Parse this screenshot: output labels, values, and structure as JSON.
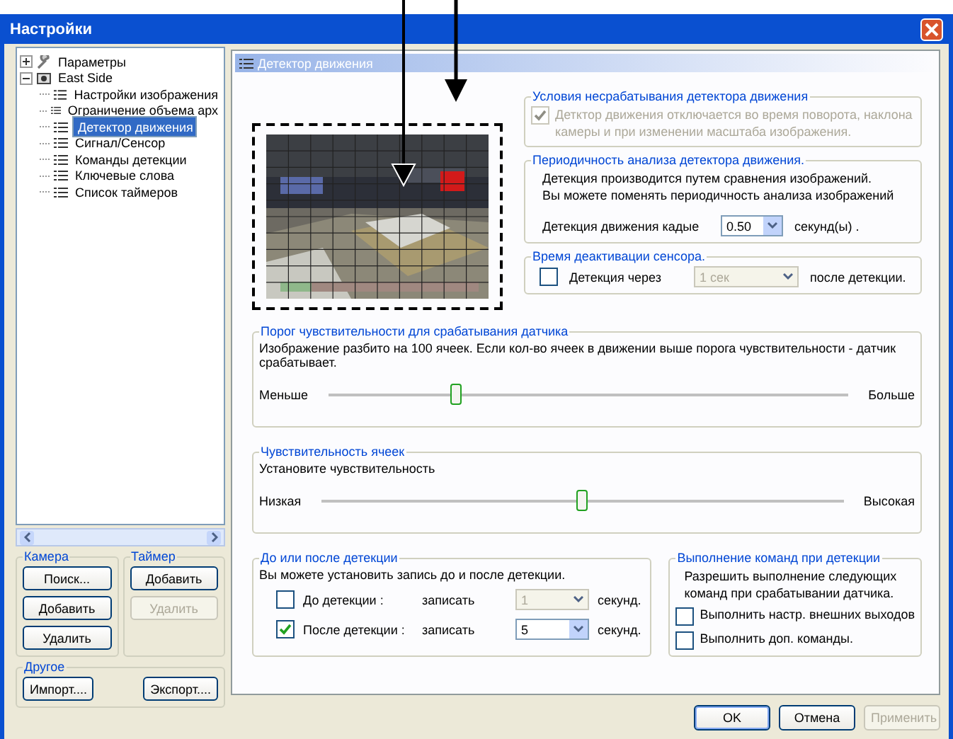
{
  "window": {
    "title": "Настройки"
  },
  "tree": [
    {
      "label": "Параметры",
      "kind": "settings",
      "expanded": false,
      "selected": false
    },
    {
      "label": "East Side",
      "kind": "camera",
      "expanded": true,
      "selected": false,
      "children": [
        {
          "label": "Настройки изображения",
          "kind": "page",
          "selected": false
        },
        {
          "label": "Ограничение объема арх",
          "kind": "page",
          "selected": false
        },
        {
          "label": "Детектор движения",
          "kind": "page",
          "selected": true
        },
        {
          "label": "Сигнал/Сенсор",
          "kind": "page",
          "selected": false
        },
        {
          "label": "Команды детекции",
          "kind": "page",
          "selected": false
        },
        {
          "label": "Ключевые слова",
          "kind": "page",
          "selected": false
        },
        {
          "label": "Список таймеров",
          "kind": "page",
          "selected": false
        }
      ]
    }
  ],
  "camera_group": {
    "title": "Камера",
    "buttons": [
      {
        "label": "Поиск...",
        "disabled": false
      },
      {
        "label": "Добавить",
        "disabled": false
      },
      {
        "label": "Удалить",
        "disabled": false
      }
    ]
  },
  "timer_group": {
    "title": "Таймер",
    "buttons": [
      {
        "label": "Добавить",
        "disabled": false
      },
      {
        "label": "Удалить",
        "disabled": true
      }
    ]
  },
  "other_group": {
    "title": "Другое",
    "buttons": [
      {
        "label": "Импорт....",
        "disabled": false
      },
      {
        "label": "Экспорт....",
        "disabled": false
      }
    ]
  },
  "panel": {
    "title": "Детектор движения"
  },
  "no_trigger": {
    "title": "Условия несрабатывания детектора движения",
    "checkbox": {
      "label": "Детктор движения отключается во время поворота, наклона камеры и при изменении масштаба изображения.",
      "checked": true,
      "disabled": true
    }
  },
  "period": {
    "title": "Периодичность анализа детектора движения.",
    "lines": [
      "Детекция производится путем сравнения изображений.",
      "Вы можете поменять периодичность анализа изображений"
    ],
    "label": "Детекция движения кадые",
    "value": "0.50",
    "unit": "секунд(ы) ."
  },
  "deactivation": {
    "title": "Время деактивации сенсора.",
    "checkbox": {
      "label": "Детекция через",
      "checked": false
    },
    "select": {
      "value": "1 сек",
      "disabled": true
    },
    "suffix": "после детекции."
  },
  "threshold": {
    "title": "Порог чувствительности для срабатывания датчика",
    "text": "Изображение разбито на 100 ячеек. Если кол-во ячеек в движении выше порога чувствительности - датчик срабатывает.",
    "min_label": "Меньше",
    "max_label": "Больше",
    "level": 0.245
  },
  "cell_sensitivity": {
    "title": "Чувствительность ячеек",
    "text": "Установите чувствительность",
    "min_label": "Низкая",
    "max_label": "Высокая",
    "level": 0.5
  },
  "record": {
    "title": "До или после детекции",
    "text": "Вы можете установить запись до и после детекции.",
    "rows": [
      {
        "label": "До детекции :",
        "checked": false,
        "action": "записать",
        "value": "1",
        "disabled": true,
        "unit": "секунд."
      },
      {
        "label": "После детекции :",
        "checked": true,
        "action": "записать",
        "value": "5",
        "disabled": false,
        "unit": "секунд."
      }
    ]
  },
  "commands": {
    "title": "Выполнение команд при детекции",
    "text": "Разрешить выполнение следующих команд при срабатывании датчика.",
    "options": [
      {
        "label": "Выполнить настр. внешних выходов",
        "checked": false
      },
      {
        "label": "Выполнить доп. команды.",
        "checked": false
      }
    ]
  },
  "footer_buttons": [
    {
      "label": "OK",
      "disabled": false,
      "default": true
    },
    {
      "label": "Отмена",
      "disabled": false,
      "default": false
    },
    {
      "label": "Применить",
      "disabled": true,
      "default": false
    }
  ]
}
